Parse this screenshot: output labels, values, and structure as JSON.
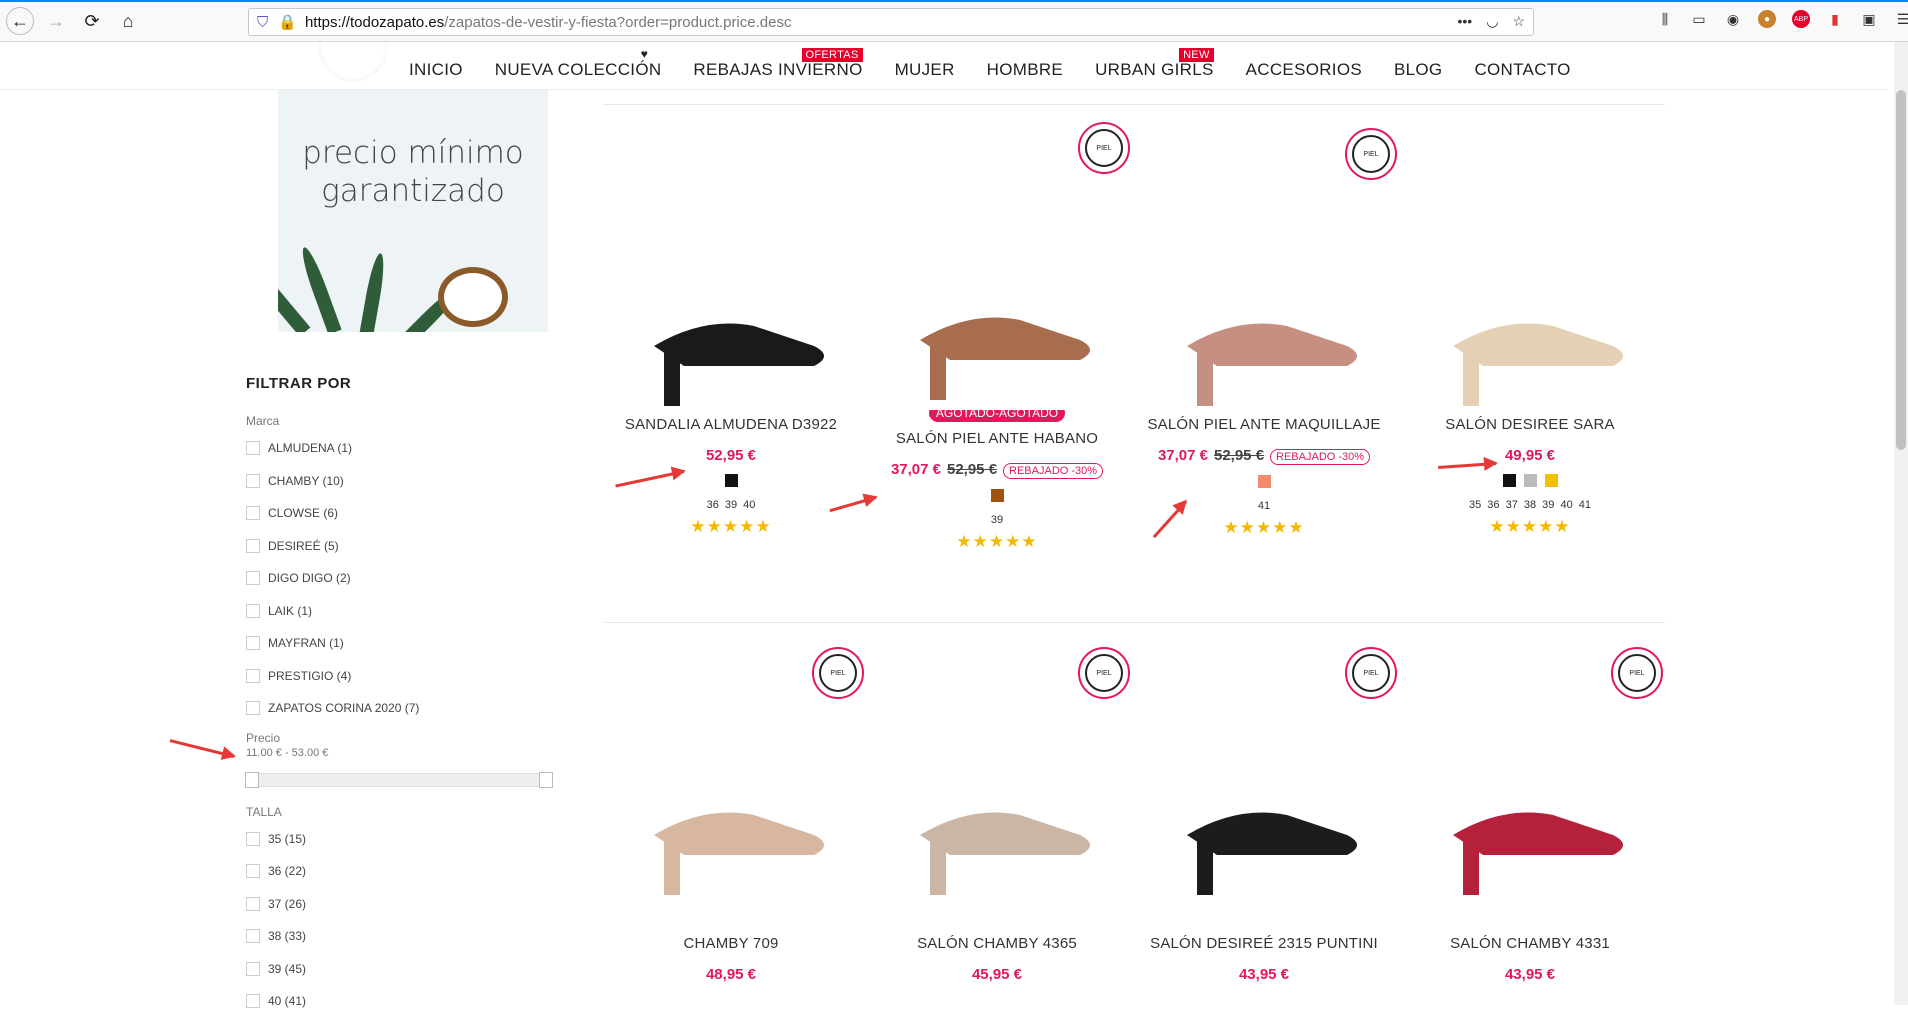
{
  "browser": {
    "url_domain": "https://todozapato.es",
    "url_path": "/zapatos-de-vestir-y-fiesta?order=product.price.desc",
    "more_icon": "ellipsis-icon"
  },
  "menu": {
    "items": [
      {
        "label": "INICIO"
      },
      {
        "label": "NUEVA COLECCIÓN"
      },
      {
        "label": "REBAJAS INVIERNO",
        "badge": "OFERTAS"
      },
      {
        "label": "MUJER"
      },
      {
        "label": "HOMBRE"
      },
      {
        "label": "URBAN GIRLS",
        "badge": "NEW"
      },
      {
        "label": "ACCESORIOS"
      },
      {
        "label": "BLOG"
      },
      {
        "label": "CONTACTO"
      }
    ],
    "heart_glyph": "♥"
  },
  "banner": {
    "line1": "precio mínimo",
    "line2": "garantizado"
  },
  "sidebar": {
    "title": "FILTRAR POR",
    "brand_label": "Marca",
    "brands": [
      "ALMUDENA (1)",
      "CHAMBY (10)",
      "CLOWSE (6)",
      "DESIREÉ (5)",
      "DIGO DIGO (2)",
      "LAIK (1)",
      "MAYFRAN (1)",
      "PRESTIGIO (4)",
      "ZAPATOS CORINA 2020 (7)"
    ],
    "price_label": "Precio",
    "price_range": "11.00 € - 53.00 €",
    "size_label": "TALLA",
    "sizes": [
      "35 (15)",
      "36 (22)",
      "37 (26)",
      "38 (33)",
      "39 (45)",
      "40 (41)"
    ]
  },
  "products": [
    {
      "name": "SANDALIA ALMUDENA D3922",
      "price": "52,95 €",
      "old": "",
      "disc": "",
      "sold": "",
      "colors": [
        "#111111"
      ],
      "sizes": "36 39 40",
      "stars": "★★★★★",
      "piel": ""
    },
    {
      "name": "SALÓN PIEL ANTE HABANO",
      "price": "37,07 €",
      "old": "52,95 €",
      "disc": "REBAJADO -30%",
      "sold": "AGOTADO-AGOTADO",
      "colors": [
        "#a0520e"
      ],
      "sizes": "39",
      "stars": "★★★★★",
      "piel": "PIEL"
    },
    {
      "name": "SALÓN PIEL ANTE MAQUILLAJE",
      "price": "37,07 €",
      "old": "52,95 €",
      "disc": "REBAJADO -30%",
      "sold": "",
      "colors": [
        "#f28b6e"
      ],
      "sizes": "41",
      "stars": "★★★★★",
      "piel": "PIEL"
    },
    {
      "name": "SALÓN DESIREE SARA",
      "price": "49,95 €",
      "old": "",
      "disc": "",
      "sold": "",
      "colors": [
        "#111111",
        "#bbbbbb",
        "#f2c200"
      ],
      "sizes": "35 36 37 38 39 40 41",
      "stars": "★★★★★",
      "piel": ""
    },
    {
      "name": "CHAMBY 709",
      "price": "48,95 €",
      "piel": "PIEL"
    },
    {
      "name": "SALÓN CHAMBY 4365",
      "price": "45,95 €",
      "piel": "PIEL"
    },
    {
      "name": "SALÓN DESIREÉ 2315 PUNTINI",
      "price": "43,95 €",
      "piel": "PIEL"
    },
    {
      "name": "SALÓN CHAMBY 4331",
      "price": "43,95 €",
      "piel": "PIEL"
    }
  ]
}
